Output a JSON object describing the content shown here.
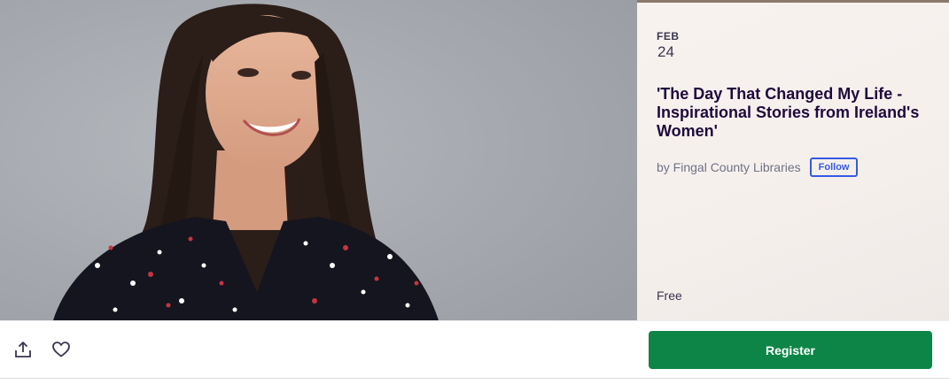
{
  "event": {
    "month": "FEB",
    "day": "24",
    "title": "'The Day That Changed My Life - Inspirational Stories from Ireland's Women'",
    "organizer": "by Fingal County Libraries",
    "follow_label": "Follow",
    "price": "Free"
  },
  "actions": {
    "share_icon": "share-icon",
    "like_icon": "heart-icon",
    "register_label": "Register"
  },
  "colors": {
    "register": "#0d8547",
    "follow": "#3659e3",
    "title": "#1e0a3c"
  }
}
